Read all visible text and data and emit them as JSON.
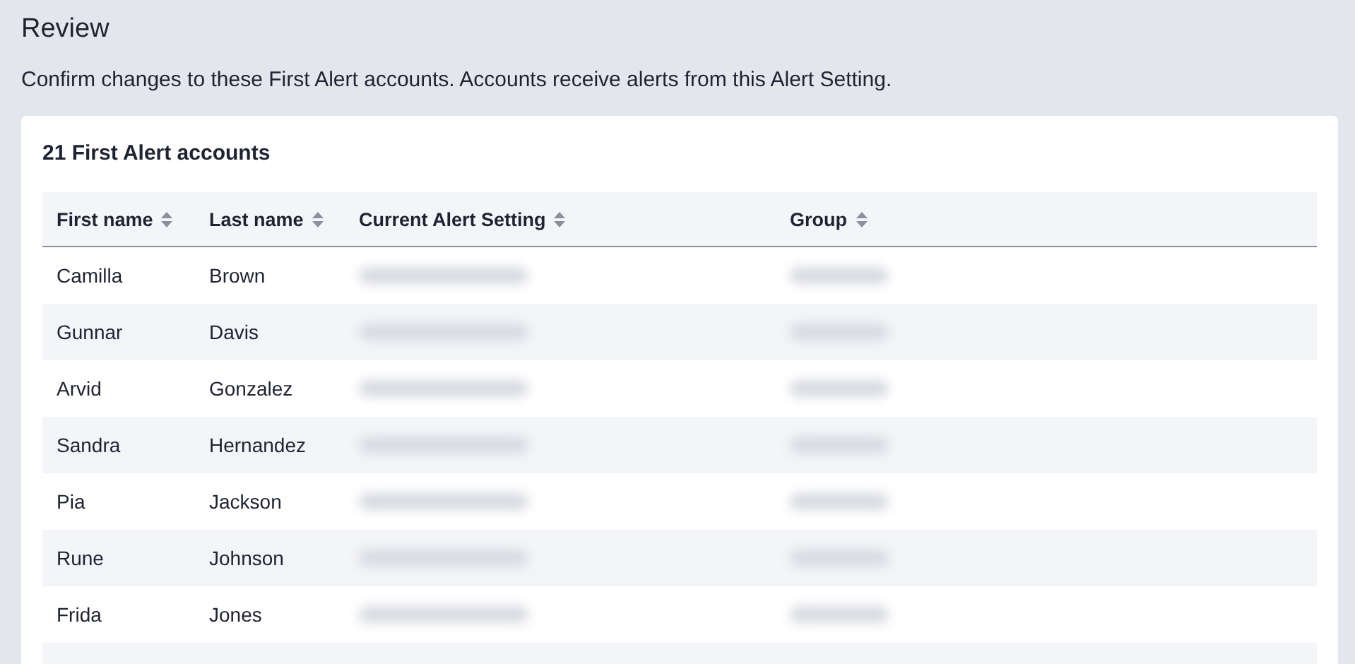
{
  "title": "Review",
  "description": "Confirm changes to these First Alert accounts. Accounts receive alerts from this Alert Setting.",
  "card": {
    "title": "21 First Alert accounts",
    "columns": [
      {
        "label": "First name",
        "sortable": true
      },
      {
        "label": "Last name",
        "sortable": true
      },
      {
        "label": "Current Alert Setting",
        "sortable": true
      },
      {
        "label": "Group",
        "sortable": true
      }
    ],
    "rows": [
      {
        "first_name": "Camilla",
        "last_name": "Brown",
        "setting_redacted": true,
        "group_redacted": true
      },
      {
        "first_name": "Gunnar",
        "last_name": "Davis",
        "setting_redacted": true,
        "group_redacted": true
      },
      {
        "first_name": "Arvid",
        "last_name": "Gonzalez",
        "setting_redacted": true,
        "group_redacted": true
      },
      {
        "first_name": "Sandra",
        "last_name": "Hernandez",
        "setting_redacted": true,
        "group_redacted": true
      },
      {
        "first_name": "Pia",
        "last_name": "Jackson",
        "setting_redacted": true,
        "group_redacted": true
      },
      {
        "first_name": "Rune",
        "last_name": "Johnson",
        "setting_redacted": true,
        "group_redacted": true
      },
      {
        "first_name": "Frida",
        "last_name": "Jones",
        "setting_redacted": true,
        "group_redacted": true
      }
    ]
  }
}
